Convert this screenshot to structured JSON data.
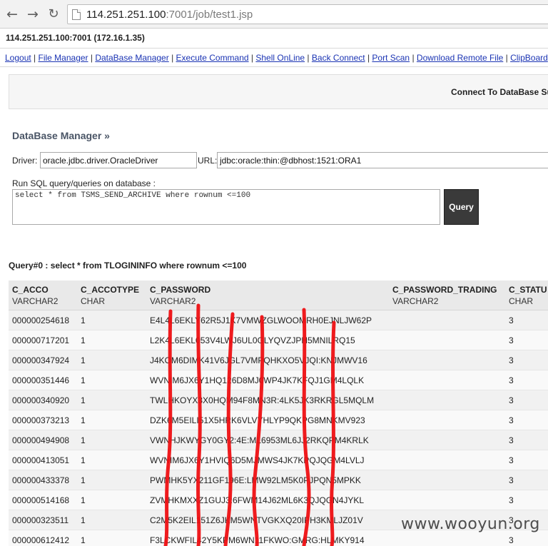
{
  "browser": {
    "url_host": "114.251.251.100",
    "url_rest": ":7001/job/test1.jsp",
    "icons": [
      "back-arrow-icon",
      "forward-arrow-icon",
      "reload-icon",
      "page-icon"
    ]
  },
  "host_line": "114.251.251.100:7001 (172.16.1.35)",
  "menu": {
    "links": [
      "Logout",
      "File Manager",
      "DataBase Manager",
      "Execute Command",
      "Shell OnLine",
      "Back Connect",
      "Port Scan",
      "Download Remote File",
      "ClipBoard"
    ],
    "separator": " | "
  },
  "connect_title": "Connect To DataBase Su",
  "db_manager": {
    "title": "DataBase Manager »",
    "driver_label": "Driver:",
    "driver_value": "oracle.jdbc.driver.OracleDriver",
    "url_label": "URL:",
    "url_value": "jdbc:oracle:thin:@dbhost:1521:ORA1",
    "sql_label": "Run SQL query/queries on database :",
    "sql_value": "select * from TSMS_SEND_ARCHIVE where rownum <=100",
    "query_button": "Query"
  },
  "result": {
    "heading": "Query#0 : select * from TLOGININFO where rownum <=100",
    "columns": [
      {
        "name": "C_ACCO",
        "type": "VARCHAR2"
      },
      {
        "name": "C_ACCOTYPE",
        "type": "CHAR"
      },
      {
        "name": "C_PASSWORD",
        "type": "VARCHAR2"
      },
      {
        "name": "C_PASSWORD_TRADING",
        "type": "VARCHAR2"
      },
      {
        "name": "C_STATU",
        "type": "CHAR"
      }
    ],
    "rows": [
      [
        "000000254618",
        "1",
        "E4L4L6EKLY62R5J1K7VMWZGLWOOMRH0EJNLJW62P",
        "",
        "3"
      ],
      [
        "000000717201",
        "1",
        "L2K4L6EKL053V4LWJ6UL0GLYQVZJPH5MNILRQ15",
        "",
        "3"
      ],
      [
        "000000347924",
        "1",
        "J4KOM6DIMK41V6JGL7VMPQHKXO5VJQI:KNJMWV16",
        "",
        "3"
      ],
      [
        "000000351446",
        "1",
        "WVNIM6JX6Y1HQ126D8MJ0WP4JK7KFQJ1GM4LQLK",
        "",
        "3"
      ],
      [
        "000000340920",
        "1",
        "TWLHKOYX3X0HQM94F8MN3R:4LK5JK3RKRGL5MQLM",
        "",
        "3"
      ],
      [
        "000000373213",
        "1",
        "DZK6M5EILI51X5HRK6VLVYHLYP9QKPG8MNKMV923",
        "",
        "3"
      ],
      [
        "000000494908",
        "1",
        "VWNHJKWYGY0GY2:4E:ML6953ML6JJ2RKQPM4KRLK",
        "",
        "3"
      ],
      [
        "000000413051",
        "1",
        "WVNIM6JX6Y1HVIQ6D5MJMWS4JK7KPQJQGM4LVLJ",
        "",
        "3"
      ],
      [
        "000000433378",
        "1",
        "PWMHK5YX211GF196E:LMW92LM5K0PJPQN5MPKK",
        "",
        "3"
      ],
      [
        "000000514168",
        "1",
        "ZVMHKMXXZ1GUJ3:6FWM14J62ML6K3QJQGN4JYKL",
        "",
        "3"
      ],
      [
        "000000323511",
        "1",
        "C2M5K2EIL151Z6JKM5WNTVGKXQ20IPH3KMLJZ01V",
        "",
        "3"
      ],
      [
        "000000612412",
        "1",
        "F3LCKWFIL42Y5KPM6WN11FKWO:GMRG:HLMKY914",
        "",
        "3"
      ]
    ]
  },
  "watermark": "www.wooyun.org"
}
